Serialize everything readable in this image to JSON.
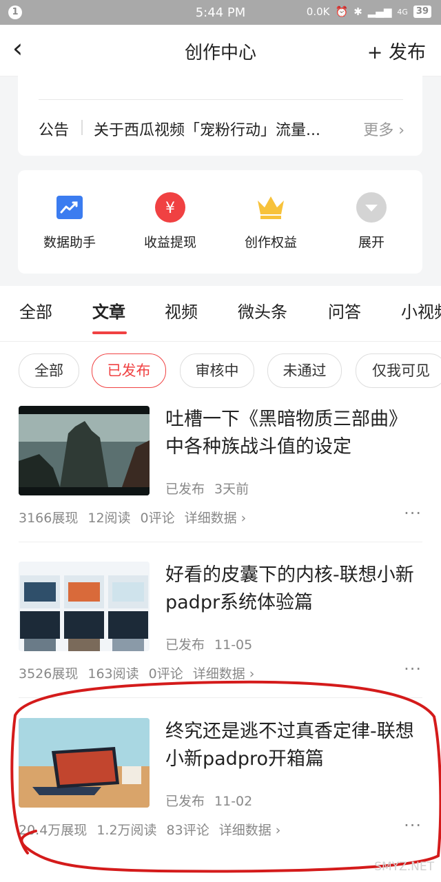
{
  "status_bar": {
    "notification_count": "1",
    "time": "5:44 PM",
    "net_speed": "0.0K",
    "network": "4G",
    "battery": "39"
  },
  "nav": {
    "title": "创作中心",
    "publish_label": "+ 发布"
  },
  "notice": {
    "label": "公告",
    "text": "关于西瓜视频「宠粉行动」流量...",
    "more": "更多 ›"
  },
  "tools": [
    {
      "label": "数据助手",
      "icon": "chart-icon"
    },
    {
      "label": "收益提现",
      "icon": "yuan-icon"
    },
    {
      "label": "创作权益",
      "icon": "crown-icon"
    },
    {
      "label": "展开",
      "icon": "expand-icon"
    }
  ],
  "tabs": [
    "全部",
    "文章",
    "视频",
    "微头条",
    "问答",
    "小视频"
  ],
  "active_tab": "文章",
  "filters": [
    "全部",
    "已发布",
    "审核中",
    "未通过",
    "仅我可见"
  ],
  "active_filter": "已发布",
  "posts": [
    {
      "title": "吐槽一下《黑暗物质三部曲》中各种族战斗值的设定",
      "status": "已发布",
      "time": "3天前",
      "views": "3166展现",
      "reads": "12阅读",
      "comments": "0评论",
      "detail": "详细数据 ›"
    },
    {
      "title": "好看的皮囊下的内核-联想小新padpr系统体验篇",
      "status": "已发布",
      "time": "11-05",
      "views": "3526展现",
      "reads": "163阅读",
      "comments": "0评论",
      "detail": "详细数据 ›"
    },
    {
      "title": "终究还是逃不过真香定律-联想小新padpro开箱篇",
      "status": "已发布",
      "time": "11-02",
      "views": "20.4万展现",
      "reads": "1.2万阅读",
      "comments": "83评论",
      "detail": "详细数据 ›"
    }
  ],
  "more_icon": "···",
  "watermark": "SMYZ.NET",
  "colors": {
    "accent": "#f04142",
    "statusbar": "#a9a9a9",
    "blue": "#3b7cf0",
    "gold": "#f7c23b"
  }
}
